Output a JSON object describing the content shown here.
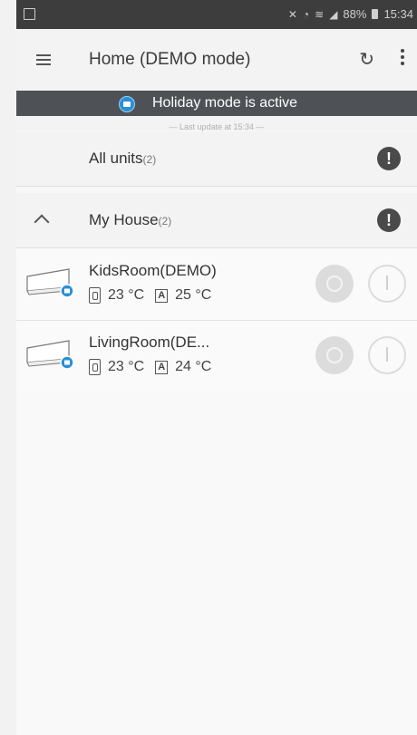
{
  "status_bar": {
    "battery": "88%",
    "time": "15:34"
  },
  "app_bar": {
    "title": "Home (DEMO mode)",
    "icons": [
      "menu-icon",
      "refresh-icon",
      "more-vert-icon"
    ]
  },
  "banner": {
    "text": "Holiday mode is active",
    "last_update": "— Last update at 15:34 —"
  },
  "groups": [
    {
      "label": "All units",
      "count": "(2)"
    },
    {
      "label": "My House",
      "count": "(2)"
    }
  ],
  "units": [
    {
      "name": "KidsRoom(DEMO)",
      "room_temp": "23 °C",
      "set_temp": "25 °C"
    },
    {
      "name": "LivingRoom(DE...",
      "room_temp": "23 °C",
      "set_temp": "24 °C"
    }
  ],
  "colors": {
    "accent": "#2c8fd6",
    "banner_bg": "#4e5257",
    "status_bg": "#3d3d3d"
  }
}
